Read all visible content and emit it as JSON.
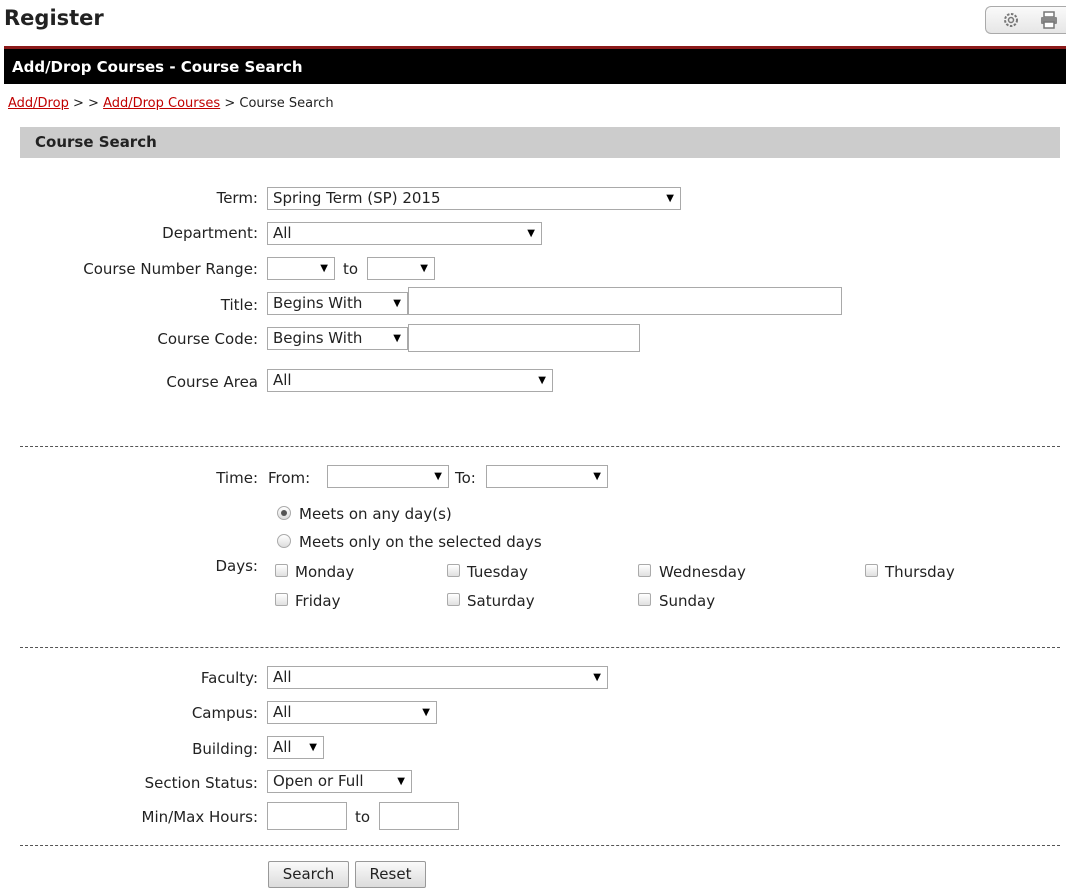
{
  "header": {
    "title": "Register",
    "icons": [
      "gear-icon",
      "print-icon"
    ]
  },
  "titlebar": {
    "title": "Add/Drop Courses - Course Search"
  },
  "breadcrumb": {
    "items": [
      "Add/Drop",
      "Add/Drop Courses",
      "Add/Drop Courses"
    ],
    "separator": ">",
    "current": "Course Search"
  },
  "section": {
    "title": "Course Search"
  },
  "form": {
    "term": {
      "label": "Term:",
      "value": "Spring Term (SP) 2015"
    },
    "department": {
      "label": "Department:",
      "value": "All"
    },
    "course_number_range": {
      "label": "Course Number Range:",
      "from": "",
      "to_label": "to",
      "to": ""
    },
    "title": {
      "label": "Title:",
      "mode": "Begins With",
      "value": ""
    },
    "course_code": {
      "label": "Course Code:",
      "mode": "Begins With",
      "value": ""
    },
    "course_area": {
      "label": "Course Area",
      "value": "All"
    },
    "time": {
      "label": "Time:",
      "from_label": "From:",
      "from": "",
      "to_label": "To:",
      "to": ""
    },
    "days": {
      "label": "Days:",
      "radio_any": "Meets on any day(s)",
      "radio_selected": "Meets only on the selected days",
      "selected_option": "any",
      "weekdays": [
        "Monday",
        "Tuesday",
        "Wednesday",
        "Thursday",
        "Friday",
        "Saturday",
        "Sunday"
      ]
    },
    "faculty": {
      "label": "Faculty:",
      "value": "All"
    },
    "campus": {
      "label": "Campus:",
      "value": "All"
    },
    "building": {
      "label": "Building:",
      "value": "All"
    },
    "section_status": {
      "label": "Section Status:",
      "value": "Open or Full"
    },
    "hours": {
      "label": "Min/Max Hours:",
      "min": "",
      "to_label": "to",
      "max": ""
    }
  },
  "buttons": {
    "search": "Search",
    "reset": "Reset"
  }
}
